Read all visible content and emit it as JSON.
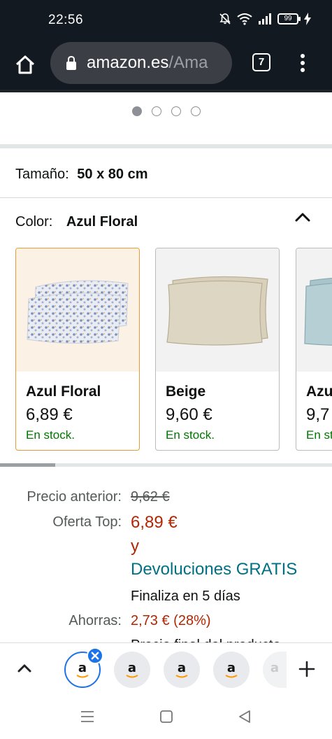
{
  "status_bar": {
    "time": "22:56",
    "battery": "99"
  },
  "browser": {
    "url_host": "amazon.es",
    "url_path": "/Ama",
    "tab_count": "7"
  },
  "carousel": {
    "dot_count": 4,
    "active_index": 0
  },
  "size": {
    "label": "Tamaño:",
    "value": "50 x 80 cm"
  },
  "color": {
    "label": "Color:",
    "value": "Azul Floral",
    "options": [
      {
        "name": "Azul Floral",
        "price": "6,89 €",
        "stock": "En stock.",
        "selected": true
      },
      {
        "name": "Beige",
        "price": "9,60 €",
        "stock": "En stock.",
        "selected": false
      },
      {
        "name": "Azu",
        "price": "9,7",
        "stock": "En st",
        "selected": false
      }
    ]
  },
  "pricing": {
    "previous_label": "Precio anterior:",
    "previous_value": "9,62 €",
    "offer_label": "Oferta Top:",
    "offer_value": "6,89 €",
    "connector": "y",
    "returns": "Devoluciones GRATIS",
    "ends": "Finaliza en 5 días",
    "savings_label": "Ahorras:",
    "savings_value": "2,73 € (28%)",
    "cut_line": "Precio final del producto"
  },
  "colors": {
    "header_bg": "#131921",
    "price_red": "#b12704",
    "link_teal": "#007185",
    "stock_green": "#007600",
    "selected_border": "#e59c36"
  }
}
